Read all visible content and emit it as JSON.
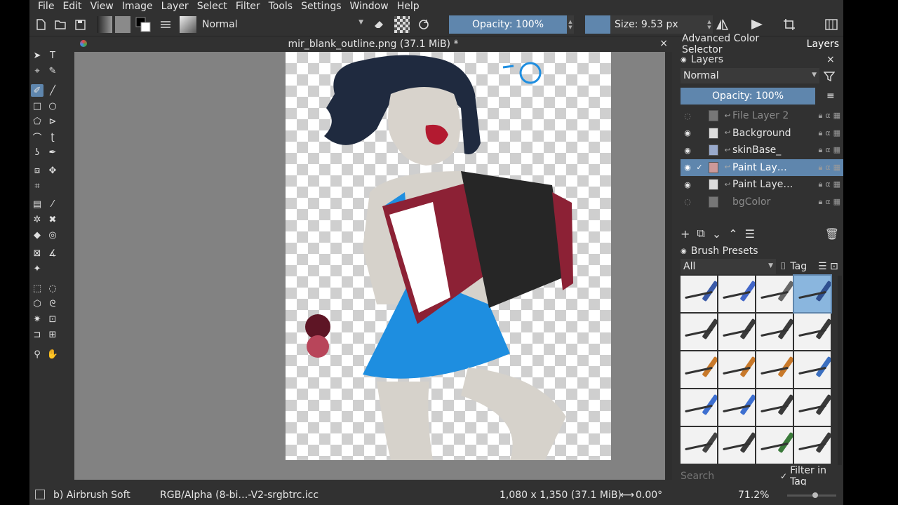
{
  "menu": [
    "File",
    "Edit",
    "View",
    "Image",
    "Layer",
    "Select",
    "Filter",
    "Tools",
    "Settings",
    "Window",
    "Help"
  ],
  "toolbar": {
    "blend_mode": "Normal",
    "opacity": "Opacity: 100%",
    "size": "Size: 9.53 px"
  },
  "document": {
    "tab_title": "mir_blank_outline.png (37.1 MiB) *"
  },
  "dock": {
    "tabs": [
      "Advanced Color Selector",
      "Layers"
    ],
    "layers_panel_title": "Layers",
    "layer_blend": "Normal",
    "layer_opacity": "Opacity:  100%",
    "layers": [
      {
        "name": "File Layer 2",
        "visible": false,
        "selected": false,
        "dim": true
      },
      {
        "name": "Background",
        "visible": true,
        "selected": false,
        "dim": false
      },
      {
        "name": "skinBase_",
        "visible": true,
        "selected": false,
        "dim": false
      },
      {
        "name": "Paint Lay…",
        "visible": true,
        "selected": true,
        "dim": false
      },
      {
        "name": "Paint Laye…",
        "visible": true,
        "selected": false,
        "dim": false
      },
      {
        "name": "bgColor",
        "visible": false,
        "selected": false,
        "dim": true
      }
    ],
    "brush_presets_title": "Brush Presets",
    "brush_filter": "All",
    "tag_label": "Tag",
    "search_placeholder": "Search",
    "filter_in_tag": "Filter in Tag"
  },
  "status": {
    "brush": "b) Airbrush Soft",
    "color_space": "RGB/Alpha (8-bi…-V2-srgbtrc.icc",
    "dimensions": "1,080 x 1,350 (37.1 MiB)",
    "rotation": "0.00°",
    "zoom": "71.2%"
  },
  "colors": {
    "accent": "#5f86ad",
    "panel": "#313131",
    "viewport": "#828282"
  },
  "icons": [
    "new-document-icon",
    "open-icon",
    "save-icon",
    "eraser-icon",
    "rotate-icon",
    "mirror-icon",
    "filter-icon",
    "eye-icon",
    "lock-icon",
    "add-layer-icon",
    "trash-icon"
  ]
}
